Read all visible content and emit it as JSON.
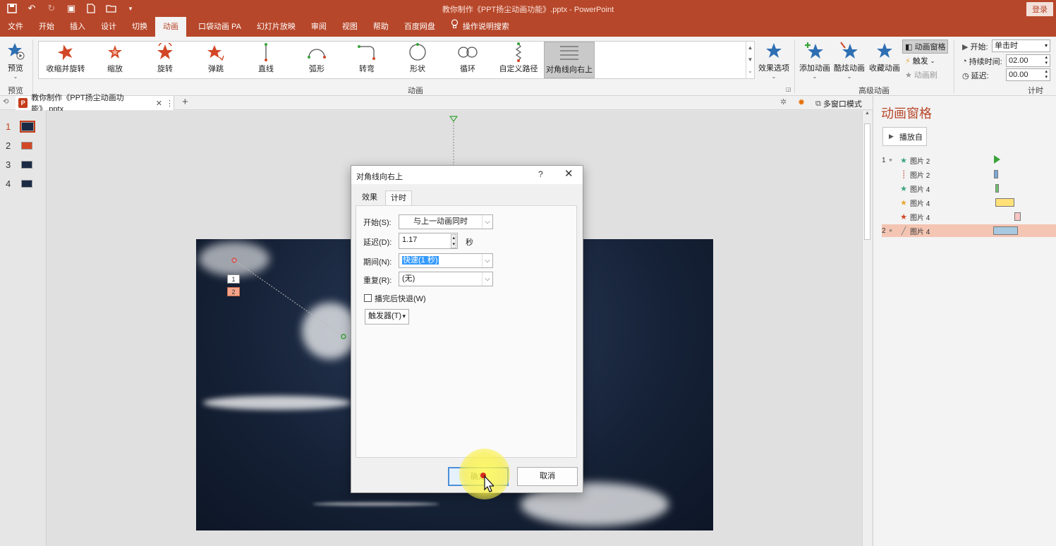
{
  "window": {
    "title": "教你制作《PPT扬尘动画功能》.pptx  -  PowerPoint",
    "login": "登录"
  },
  "tabs": [
    "文件",
    "开始",
    "插入",
    "设计",
    "切换",
    "动画",
    "口袋动画 PA",
    "幻灯片放映",
    "审阅",
    "视图",
    "帮助",
    "百度网盘"
  ],
  "active_tab": "动画",
  "tell_me": "操作说明搜索",
  "ribbon": {
    "preview_label": "预览",
    "preview_group": "预览",
    "animation_group": "动画",
    "gallery": [
      {
        "label": "收缩并旋转",
        "icon": "star-spin-icon"
      },
      {
        "label": "缩放",
        "icon": "star-zoom-icon"
      },
      {
        "label": "旋转",
        "icon": "star-rotate-icon"
      },
      {
        "label": "弹跳",
        "icon": "star-bounce-icon"
      },
      {
        "label": "直线",
        "icon": "path-line-icon"
      },
      {
        "label": "弧形",
        "icon": "path-arc-icon"
      },
      {
        "label": "转弯",
        "icon": "path-turn-icon"
      },
      {
        "label": "形状",
        "icon": "path-shape-icon"
      },
      {
        "label": "循环",
        "icon": "path-loop-icon"
      },
      {
        "label": "自定义路径",
        "icon": "path-custom-icon"
      },
      {
        "label": "对角线向右上",
        "icon": "path-diagonal-icon"
      }
    ],
    "effect_options": "效果选项",
    "advanced_group": "高级动画",
    "add_animation": "添加动画",
    "anim_painter": "酷炫动画",
    "fav_animation": "收藏动画",
    "anim_pane": "动画窗格",
    "trigger": "触发",
    "anim_brush": "动画刷",
    "timing_group": "计时",
    "start_label": "开始:",
    "start_value": "单击时",
    "duration_label": "持续时间:",
    "duration_value": "02.00",
    "delay_label": "延迟:",
    "delay_value": "00.00"
  },
  "doc_tab": {
    "name": "教你制作《PPT扬尘动画功能》.pptx",
    "close": "✕",
    "more": "⋮",
    "add": "+",
    "multi_window": "多窗口模式"
  },
  "thumbnails": [
    "1",
    "2",
    "3",
    "4"
  ],
  "slide_tags": [
    "1",
    "2"
  ],
  "dialog": {
    "title": "对角线向右上",
    "help": "?",
    "close": "✕",
    "tabs": [
      "效果",
      "计时"
    ],
    "start_label": "开始(S):",
    "start_value": "与上一动画同时",
    "delay_label": "延迟(D):",
    "delay_value": "1.17",
    "delay_unit": "秒",
    "period_label": "期间(N):",
    "period_value": "快速(1 秒)",
    "repeat_label": "重复(R):",
    "repeat_value": "(无)",
    "rewind_label": "播完后快退(W)",
    "trigger_btn": "触发器(T)",
    "ok": "确定",
    "cancel": "取消"
  },
  "anim_pane": {
    "title": "动画窗格",
    "play_from": "播放自",
    "rows": [
      {
        "num": "1",
        "trigger": true,
        "icon": "★",
        "icon_color": "#3aa37a",
        "name": "图片 2",
        "bar_type": "triangle",
        "bar_color": "#3aa33a"
      },
      {
        "num": "",
        "trigger": false,
        "icon": "┊",
        "icon_color": "#c0392b",
        "name": "图片 2",
        "bar_type": "bar",
        "bar_color": "#7fa7d6"
      },
      {
        "num": "",
        "trigger": false,
        "icon": "★",
        "icon_color": "#3aa37a",
        "name": "图片 4",
        "bar_type": "bar",
        "bar_color": "#6cc26c"
      },
      {
        "num": "",
        "trigger": false,
        "icon": "★",
        "icon_color": "#e8a735",
        "name": "图片 4",
        "bar_type": "bar",
        "bar_color": "#ffe178"
      },
      {
        "num": "",
        "trigger": false,
        "icon": "★",
        "icon_color": "#d24726",
        "name": "图片 4",
        "bar_type": "bar",
        "bar_color": "#f8c6c6"
      },
      {
        "num": "2",
        "trigger": true,
        "icon": "╱",
        "icon_color": "#777777",
        "name": "图片 4",
        "bar_type": "bar",
        "bar_color": "#a9c9e0"
      }
    ]
  },
  "colors": {
    "accent": "#b7472a",
    "selection": "#f4c5b3"
  }
}
